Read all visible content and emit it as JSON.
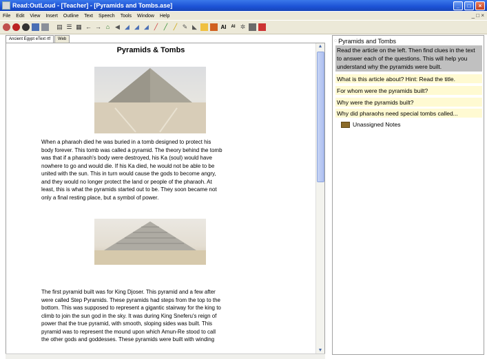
{
  "window": {
    "title": "Read:OutLoud - [Teacher] - [Pyramids and Tombs.ase]",
    "buttons": {
      "minimize": "_",
      "maximize": "□",
      "close": "×"
    }
  },
  "menu": {
    "items": [
      "File",
      "Edit",
      "View",
      "Insert",
      "Outline",
      "Text",
      "Speech",
      "Tools",
      "Window",
      "Help"
    ],
    "mdi_controls": "_ □ ×"
  },
  "toolbar": {
    "icons": [
      "home-icon",
      "stop-icon",
      "record-icon",
      "save-icon",
      "print-icon",
      "text-view-icon",
      "outline-view-icon",
      "both-view-icon",
      "back-icon",
      "forward-icon",
      "web-icon",
      "speak-icon",
      "highlight-word-icon",
      "highlight-sentence-icon",
      "highlight-paragraph-icon",
      "pen-red-icon",
      "pen-green-icon",
      "pen-yellow-icon",
      "pen-clear-icon",
      "copy-note-icon",
      "bookmark-icon",
      "notebook-icon",
      "font-large-icon",
      "font-small-icon",
      "zoom-icon",
      "tools-icon"
    ],
    "font_large_label": "AI",
    "font_small_label": "AI"
  },
  "tabs": [
    "Ancient Egypt eText rtf",
    "Web"
  ],
  "document": {
    "title": "Pyramids & Tombs",
    "paragraph1": "  When a pharaoh died he was buried in a tomb designed to protect his\nbody forever. This tomb was called a pyramid. The theory behind the tomb\nwas that if a pharaoh's body were destroyed, his Ka (soul) would have\nnowhere to go and would die. If his Ka died, he would not be able to be\nunited with the sun. This in turn would cause the gods to become angry,\nand they would no longer protect the land or people of the pharaoh. At\nleast, this is what the pyramids started out to be. They soon became not\nonly a final resting place, but a symbol of power.",
    "paragraph2": "The first pyramid built was for King Djoser. This pyramid and a few after\nwere called Step Pyramids. These pyramids had steps from the top to the\nbottom. This was supposed to represent a gigantic stairway for the king to\nclimb to join the sun god in the sky. It was during King Sneferu's reign of\npower that the true pyramid, with smooth, sloping sides was built. This\npyramid was to represent the mound upon which Amun-Re stood to call\nthe other gods and goddesses. These pyramids were built with winding"
  },
  "notes": {
    "root_title": "Pyramids and Tombs",
    "instruction": "Read the article on the left. Then find clues in the text to answer each of the questions. This will help you understand why the pyramids were built.",
    "questions": [
      "What is this article about? Hint: Read the title.",
      "For whom were the pyramids built?",
      "Why were the pyramids built?",
      "Why did pharaohs need special tombs called..."
    ],
    "unassigned": "Unassigned Notes"
  },
  "colors": {
    "title_bar": "#1c52d6",
    "question_bg": "#fffad2",
    "instruction_bg": "#c0c0c0",
    "folder": "#8a6a28"
  }
}
